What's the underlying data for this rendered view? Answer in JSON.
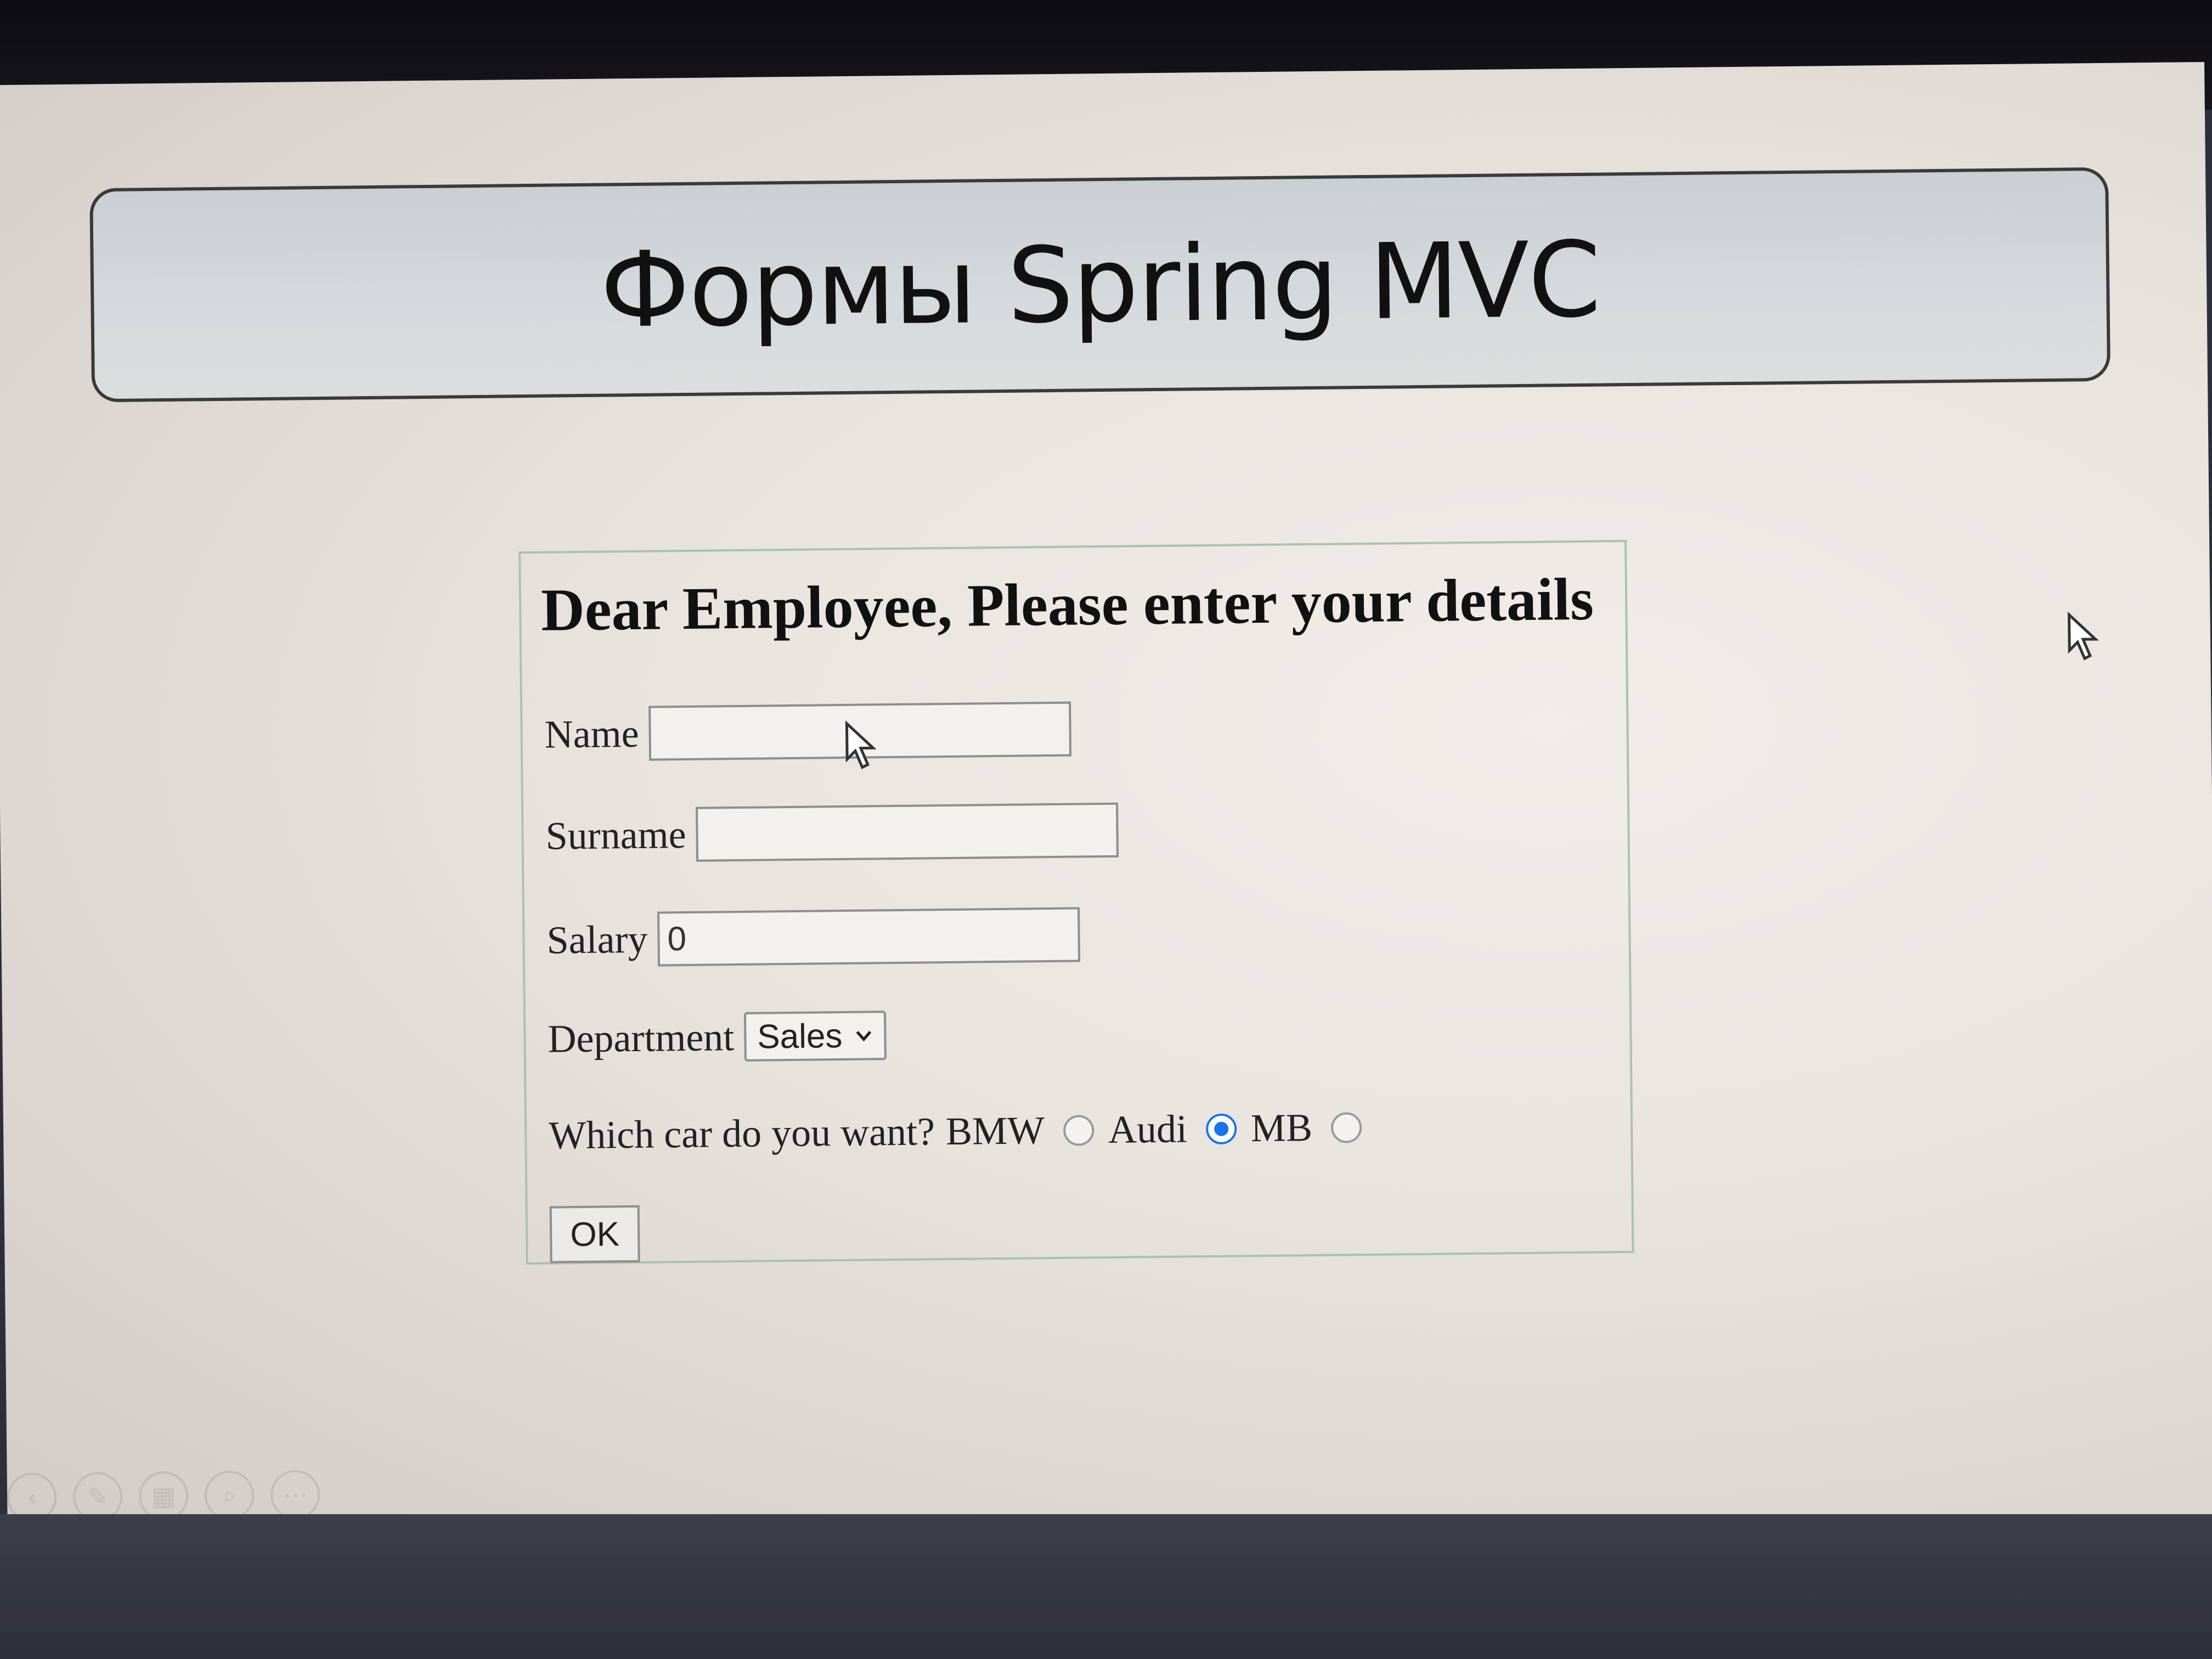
{
  "slide": {
    "title": "Формы Spring MVC"
  },
  "form": {
    "heading": "Dear Employee, Please enter your details",
    "name": {
      "label": "Name",
      "value": ""
    },
    "surname": {
      "label": "Surname",
      "value": ""
    },
    "salary": {
      "label": "Salary",
      "value": "0"
    },
    "department": {
      "label": "Department",
      "selected": "Sales"
    },
    "car": {
      "question": "Which car do you want?",
      "options": [
        {
          "label": "BMW",
          "checked": false
        },
        {
          "label": "Audi",
          "checked": true
        },
        {
          "label": "MB",
          "checked": false
        }
      ]
    },
    "submit_label": "OK"
  },
  "colors": {
    "radio_checked": "#1a73e8",
    "form_border": "#a9c3b0"
  },
  "icons": {
    "mouse_cursor": "arrow-cursor-icon",
    "select_chevron": "chevron-down-icon"
  }
}
